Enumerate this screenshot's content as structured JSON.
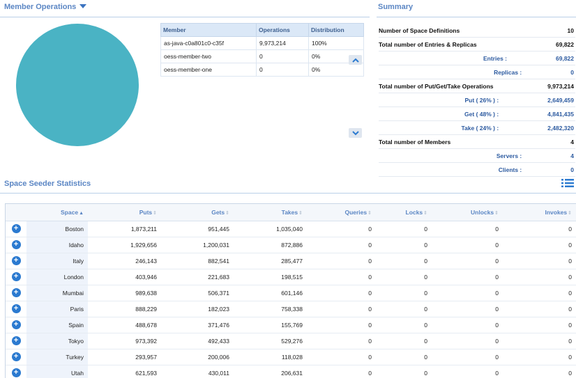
{
  "member_operations": {
    "title": "Member Operations",
    "columns": [
      "Member",
      "Operations",
      "Distribution"
    ],
    "rows": [
      {
        "member": "as-java-c0a801c0-c35f",
        "operations": "9,973,214",
        "distribution": "100%"
      },
      {
        "member": "oess-member-two",
        "operations": "0",
        "distribution": "0%"
      },
      {
        "member": "oess-member-one",
        "operations": "0",
        "distribution": "0%"
      }
    ],
    "pie_color": "#4ab3c4",
    "icons": {
      "menu": "caret-down-icon",
      "scroll_up": "chevron-up-icon",
      "scroll_down": "chevron-down-icon"
    }
  },
  "summary": {
    "title": "Summary",
    "rows": [
      {
        "label": "Number of Space Definitions",
        "value": "10"
      },
      {
        "label": "Total number of Entries & Replicas",
        "value": "69,822"
      },
      {
        "label": "Entries :",
        "value": "69,822"
      },
      {
        "label": "Replicas :",
        "value": "0"
      },
      {
        "label": "Total number of Put/Get/Take Operations",
        "value": "9,973,214"
      },
      {
        "label": "Put ( 26% ) :",
        "value": "2,649,459"
      },
      {
        "label": "Get ( 48% ) :",
        "value": "4,841,435"
      },
      {
        "label": "Take ( 24% ) :",
        "value": "2,482,320"
      },
      {
        "label": "Total number of Members",
        "value": "4"
      },
      {
        "label": "Servers :",
        "value": "4"
      },
      {
        "label": "Clients :",
        "value": "0"
      }
    ]
  },
  "seeder": {
    "title": "Space Seeder Statistics",
    "columns": [
      "Space",
      "Puts",
      "Gets",
      "Takes",
      "Queries",
      "Locks",
      "Unlocks",
      "Invokes"
    ],
    "rows": [
      [
        "Boston",
        "1,873,211",
        "951,445",
        "1,035,040",
        "0",
        "0",
        "0",
        "0"
      ],
      [
        "Idaho",
        "1,929,656",
        "1,200,031",
        "872,886",
        "0",
        "0",
        "0",
        "0"
      ],
      [
        "Italy",
        "246,143",
        "882,541",
        "285,477",
        "0",
        "0",
        "0",
        "0"
      ],
      [
        "London",
        "403,946",
        "221,683",
        "198,515",
        "0",
        "0",
        "0",
        "0"
      ],
      [
        "Mumbai",
        "989,638",
        "506,371",
        "601,146",
        "0",
        "0",
        "0",
        "0"
      ],
      [
        "Paris",
        "888,229",
        "182,023",
        "758,338",
        "0",
        "0",
        "0",
        "0"
      ],
      [
        "Spain",
        "488,678",
        "371,476",
        "155,769",
        "0",
        "0",
        "0",
        "0"
      ],
      [
        "Tokyo",
        "973,392",
        "492,433",
        "529,276",
        "0",
        "0",
        "0",
        "0"
      ],
      [
        "Turkey",
        "293,957",
        "200,006",
        "118,028",
        "0",
        "0",
        "0",
        "0"
      ],
      [
        "Utah",
        "621,593",
        "430,011",
        "206,631",
        "0",
        "0",
        "0",
        "0"
      ]
    ],
    "sorted_column": "Space",
    "expand_glyph": "+",
    "icons": {
      "list": "list-icon",
      "expand": "plus-circle-icon"
    }
  }
}
